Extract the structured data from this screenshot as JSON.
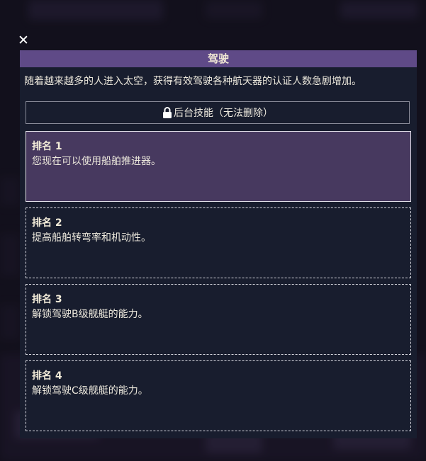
{
  "dialog": {
    "close_icon": "close-icon",
    "title": "驾驶",
    "description": "随着越来越多的人进入太空，获得有效驾驶各种航天器的认证人数急剧增加。",
    "background_skill": {
      "icon": "lock-icon",
      "label": "后台技能（无法删除）"
    },
    "ranks": [
      {
        "name": "排名 1",
        "desc": "您现在可以使用船舶推进器。",
        "active": true
      },
      {
        "name": "排名 2",
        "desc": "提高船舶转弯率和机动性。",
        "active": false
      },
      {
        "name": "排名 3",
        "desc": "解锁驾驶B级舰艇的能力。",
        "active": false
      },
      {
        "name": "排名 4",
        "desc": "解锁驾驶C级舰艇的能力。",
        "active": false
      }
    ]
  },
  "colors": {
    "title_bar": "#5f4a87",
    "panel_bg": "#181d2e",
    "active_rank_bg": "#47395f"
  }
}
